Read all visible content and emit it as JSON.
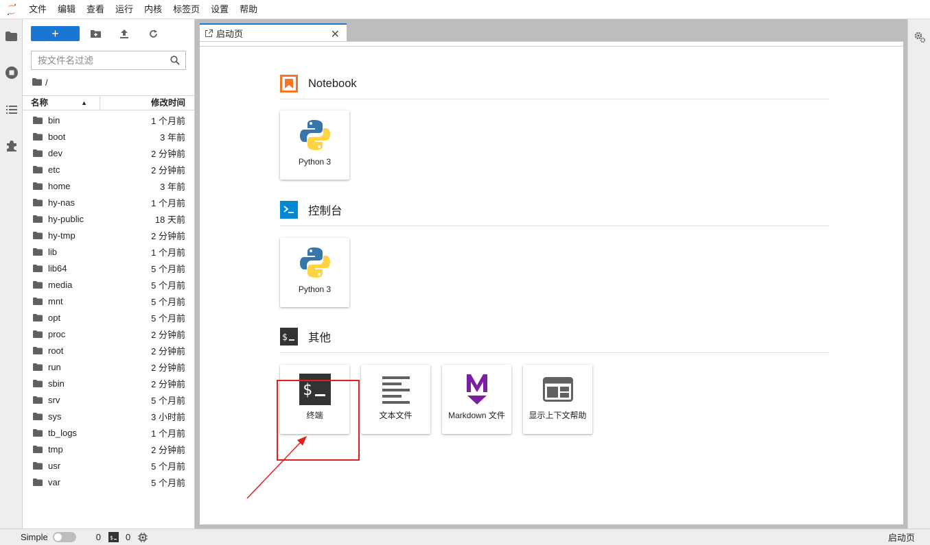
{
  "menubar": {
    "items": [
      "文件",
      "编辑",
      "查看",
      "运行",
      "内核",
      "标签页",
      "设置",
      "帮助"
    ]
  },
  "filebrowser": {
    "filter_placeholder": "按文件名过滤",
    "breadcrumb": "/",
    "col_name": "名称",
    "col_modified": "修改时间",
    "files": [
      {
        "name": "bin",
        "modified": "1 个月前"
      },
      {
        "name": "boot",
        "modified": "3 年前"
      },
      {
        "name": "dev",
        "modified": "2 分钟前"
      },
      {
        "name": "etc",
        "modified": "2 分钟前"
      },
      {
        "name": "home",
        "modified": "3 年前"
      },
      {
        "name": "hy-nas",
        "modified": "1 个月前"
      },
      {
        "name": "hy-public",
        "modified": "18 天前"
      },
      {
        "name": "hy-tmp",
        "modified": "2 分钟前"
      },
      {
        "name": "lib",
        "modified": "1 个月前"
      },
      {
        "name": "lib64",
        "modified": "5 个月前"
      },
      {
        "name": "media",
        "modified": "5 个月前"
      },
      {
        "name": "mnt",
        "modified": "5 个月前"
      },
      {
        "name": "opt",
        "modified": "5 个月前"
      },
      {
        "name": "proc",
        "modified": "2 分钟前"
      },
      {
        "name": "root",
        "modified": "2 分钟前"
      },
      {
        "name": "run",
        "modified": "2 分钟前"
      },
      {
        "name": "sbin",
        "modified": "2 分钟前"
      },
      {
        "name": "srv",
        "modified": "5 个月前"
      },
      {
        "name": "sys",
        "modified": "3 小时前"
      },
      {
        "name": "tb_logs",
        "modified": "1 个月前"
      },
      {
        "name": "tmp",
        "modified": "2 分钟前"
      },
      {
        "name": "usr",
        "modified": "5 个月前"
      },
      {
        "name": "var",
        "modified": "5 个月前"
      }
    ]
  },
  "tab": {
    "label": "启动页"
  },
  "launcher": {
    "notebook_title": "Notebook",
    "notebook_card": "Python 3",
    "console_title": "控制台",
    "console_card": "Python 3",
    "other_title": "其他",
    "other_cards": [
      "终端",
      "文本文件",
      "Markdown 文件",
      "显示上下文帮助"
    ]
  },
  "statusbar": {
    "mode": "Simple",
    "kernels": "0",
    "terminals": "0",
    "right": "启动页"
  },
  "colors": {
    "accent": "#1976d2",
    "highlight": "#e02020",
    "notebook_icon": "#f37726",
    "console_icon": "#0288d1",
    "markdown": "#7b1fa2"
  }
}
